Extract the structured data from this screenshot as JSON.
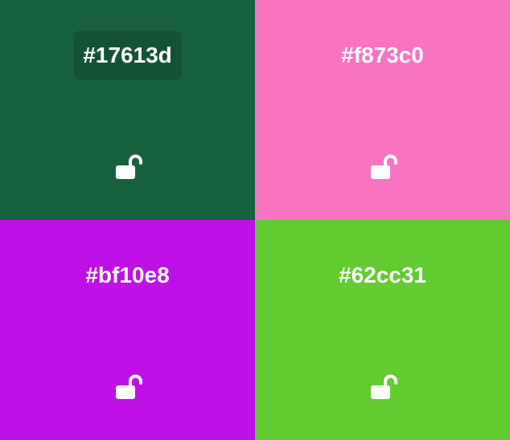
{
  "swatches": [
    {
      "hex": "#17613d",
      "color": "#17613d",
      "icon": "unlocked-padlock-icon",
      "label_highlighted": true
    },
    {
      "hex": "#f873c0",
      "color": "#f873c0",
      "icon": "unlocked-padlock-icon",
      "label_highlighted": false
    },
    {
      "hex": "#bf10e8",
      "color": "#bf10e8",
      "icon": "unlocked-padlock-icon",
      "label_highlighted": false
    },
    {
      "hex": "#62cc31",
      "color": "#62cc31",
      "icon": "unlocked-padlock-icon",
      "label_highlighted": false
    }
  ],
  "icon_color": "#ffffff"
}
